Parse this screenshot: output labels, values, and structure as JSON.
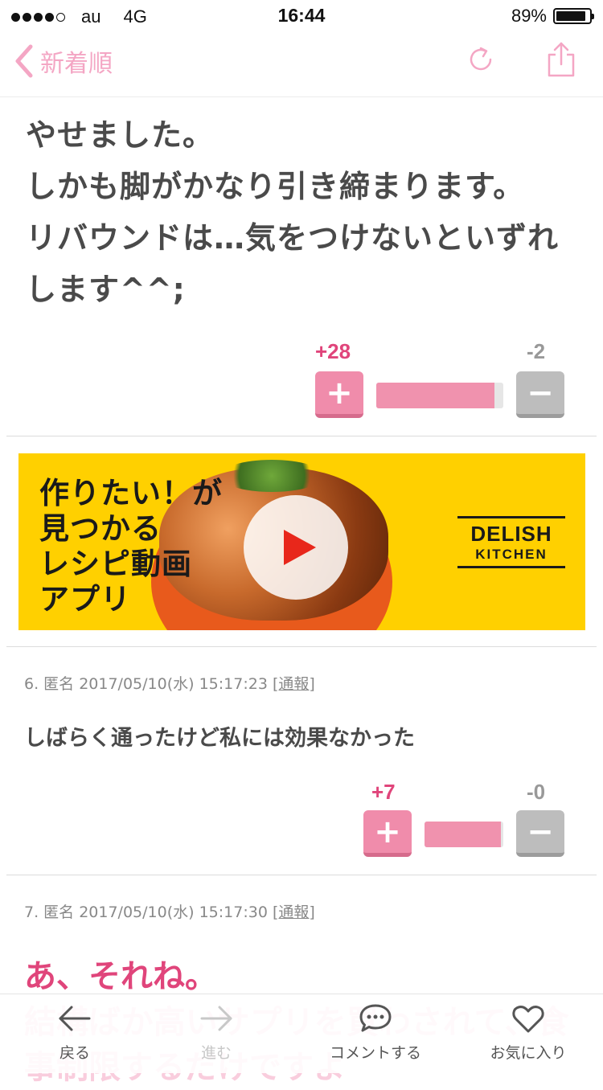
{
  "status_bar": {
    "carrier": "au",
    "network": "4G",
    "time": "16:44",
    "battery": "89%",
    "battery_level": 0.89
  },
  "nav": {
    "back_label": "新着順",
    "accent_color": "#f4a6c4"
  },
  "post5": {
    "lines": [
      "やせました。",
      "しかも脚がかなり引き締まります。",
      "リバウンドは…気をつけないといずれ",
      "します^^;"
    ],
    "plus_count": "+28",
    "minus_count": "-2",
    "plus_ratio": 0.93
  },
  "ad": {
    "lines": [
      "作りたい！が",
      "見つかる",
      "レシピ動画",
      "アプリ"
    ],
    "logo_main": "DELISH",
    "logo_sub": "KITCHEN"
  },
  "comment6": {
    "meta": "6. 匿名 2017/05/10(水) 15:17:23",
    "report": "[通報]",
    "text": "しばらく通ったけど私には効果なかった",
    "plus_count": "+7",
    "minus_count": "-0",
    "plus_ratio": 0.97
  },
  "comment7": {
    "meta": "7. 匿名 2017/05/10(水) 15:17:30",
    "report": "[通報]",
    "highlight": "あ、それね。",
    "text_partial": "結構ばか高いサプリを買わされて、食事制限するだけですよ"
  },
  "tabbar": {
    "back": "戻る",
    "forward": "進む",
    "comment": "コメントする",
    "favorite": "お気に入り"
  }
}
